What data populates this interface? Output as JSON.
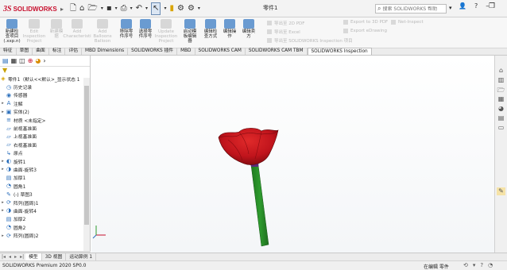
{
  "app": {
    "brand": "SOLIDWORKS",
    "brand_prefix": "3S",
    "document_title": "零件1"
  },
  "help_search": {
    "placeholder": "搜索 SOLIDWORKS 帮助"
  },
  "ribbon": {
    "buttons": [
      {
        "label": "新建检\n查项目\n(.xxp.n)",
        "dim": false
      },
      {
        "label": "Edit\nInspection\nProject",
        "dim": true
      },
      {
        "label": "新建模\n据",
        "dim": true
      },
      {
        "label": "Add\nCharacteristi",
        "dim": true
      },
      {
        "label": "Add Balloons\nBalloon",
        "dim": true
      },
      {
        "label": "移除零\n件序号",
        "dim": false
      },
      {
        "label": "选择零\n件序号",
        "dim": false
      },
      {
        "label": "Update\nInspection\nProject",
        "dim": true
      },
      {
        "label": "启动模\n板编辑\n器",
        "dim": false
      },
      {
        "label": "编辑检\n查方式",
        "dim": false
      },
      {
        "label": "编辑操\n作",
        "dim": false
      },
      {
        "label": "编辑卖\n方",
        "dim": false
      }
    ],
    "export_group": [
      "导出至 2D PDF",
      "导出至 Excel",
      "导出至 SOLIDWORKS Inspection 项目"
    ],
    "export_group2": [
      "Export to 3D PDF",
      "Export eDrawing"
    ],
    "net_inspect": "Net-Inspect"
  },
  "command_tabs": [
    "特征",
    "草图",
    "曲面",
    "标注",
    "评估",
    "MBD Dimensions",
    "SOLIDWORKS 插件",
    "MBD",
    "SOLIDWORKS CAM",
    "SOLIDWORKS CAM TBM",
    "SOLIDWORKS Inspection"
  ],
  "active_tab_index": 10,
  "feature_tree": {
    "root": "零件1（默认<<默认>_显示状态 1",
    "items": [
      {
        "label": "历史记录",
        "icon": "history-icon",
        "glyph": "◷",
        "arrow": ""
      },
      {
        "label": "传感器",
        "icon": "sensor-icon",
        "glyph": "◉",
        "arrow": ""
      },
      {
        "label": "注解",
        "icon": "annotation-icon",
        "glyph": "A",
        "arrow": "▸"
      },
      {
        "label": "实体(2)",
        "icon": "solid-bodies-icon",
        "glyph": "▣",
        "arrow": "▸"
      },
      {
        "label": "材质 <未指定>",
        "icon": "material-icon",
        "glyph": "≡",
        "arrow": ""
      },
      {
        "label": "前视基准面",
        "icon": "plane-icon",
        "glyph": "▱",
        "arrow": ""
      },
      {
        "label": "上视基准面",
        "icon": "plane-icon",
        "glyph": "▱",
        "arrow": ""
      },
      {
        "label": "右视基准面",
        "icon": "plane-icon",
        "glyph": "▱",
        "arrow": ""
      },
      {
        "label": "原点",
        "icon": "origin-icon",
        "glyph": "↳",
        "arrow": ""
      },
      {
        "label": "旋转1",
        "icon": "revolve-icon",
        "glyph": "◐",
        "arrow": "▸"
      },
      {
        "label": "曲面-旋转3",
        "icon": "surface-revolve-icon",
        "glyph": "◑",
        "arrow": "▸"
      },
      {
        "label": "加厚1",
        "icon": "thicken-icon",
        "glyph": "▤",
        "arrow": ""
      },
      {
        "label": "圆角1",
        "icon": "fillet-icon",
        "glyph": "◔",
        "arrow": ""
      },
      {
        "label": "(-) 草图3",
        "icon": "sketch-icon",
        "glyph": "✎",
        "arrow": ""
      },
      {
        "label": "阵列(圆周)1",
        "icon": "circular-pattern-icon",
        "glyph": "⟳",
        "arrow": "▸"
      },
      {
        "label": "曲面-旋转4",
        "icon": "surface-revolve-icon",
        "glyph": "◑",
        "arrow": "▸"
      },
      {
        "label": "加厚2",
        "icon": "thicken-icon",
        "glyph": "▤",
        "arrow": ""
      },
      {
        "label": "圆角2",
        "icon": "fillet-icon",
        "glyph": "◔",
        "arrow": ""
      },
      {
        "label": "阵列(圆周)2",
        "icon": "circular-pattern-icon",
        "glyph": "⟳",
        "arrow": "▸"
      }
    ]
  },
  "model_tabs": [
    "模型",
    "3D 视图",
    "运动算例 1"
  ],
  "status": {
    "left": "SOLIDWORKS Premium 2020 SP0.0",
    "right": "在编辑 零件"
  },
  "colors": {
    "rose": "#c0141c",
    "rose_dark": "#7a0a0e",
    "stem": "#2e9b2e",
    "accent": "#c8102e"
  },
  "axis_labels": {
    "x": "",
    "y": ""
  }
}
